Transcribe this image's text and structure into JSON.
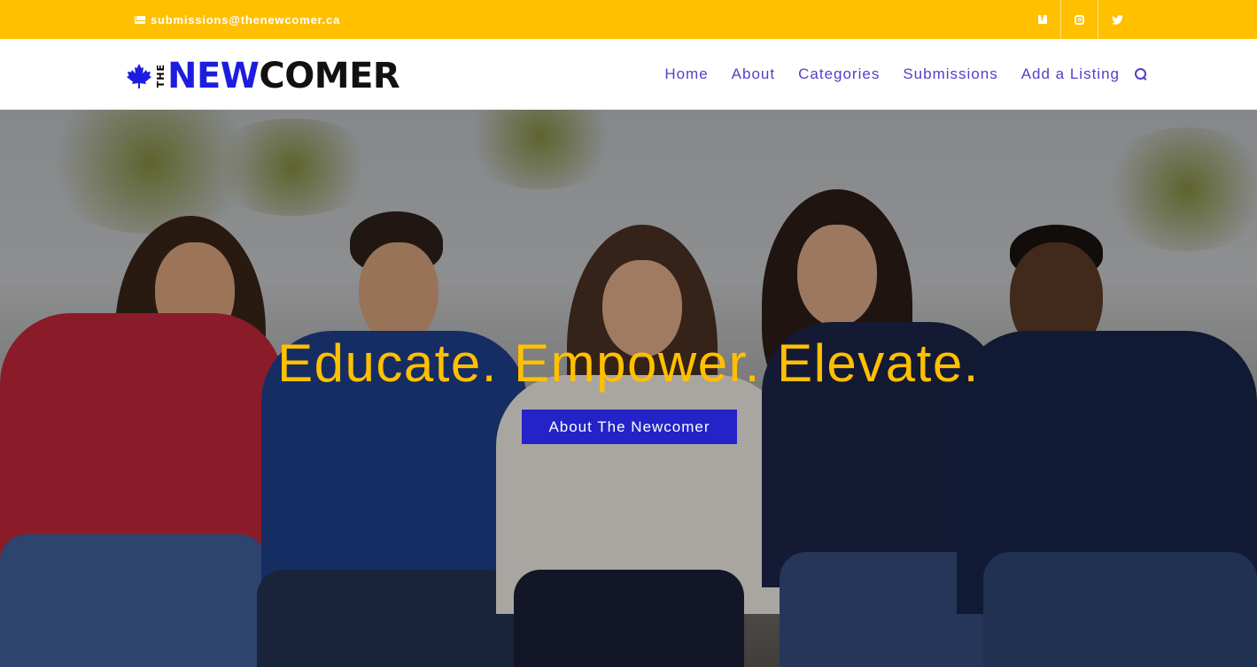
{
  "topbar": {
    "email": "submissions@thenewcomer.ca",
    "social": [
      "facebook-icon",
      "instagram-icon",
      "twitter-icon"
    ],
    "bg_color": "#ffc000"
  },
  "header": {
    "logo": {
      "the": "THE",
      "new": "NEW",
      "comer": "COMER"
    },
    "nav": [
      {
        "label": "Home"
      },
      {
        "label": "About"
      },
      {
        "label": "Categories"
      },
      {
        "label": "Submissions"
      },
      {
        "label": "Add a Listing"
      }
    ],
    "nav_color": "#5a3cc8"
  },
  "hero": {
    "headline": "Educate. Empower. Elevate.",
    "cta_label": "About The Newcomer",
    "headline_color": "#ffc000",
    "cta_color": "#2323c8"
  }
}
